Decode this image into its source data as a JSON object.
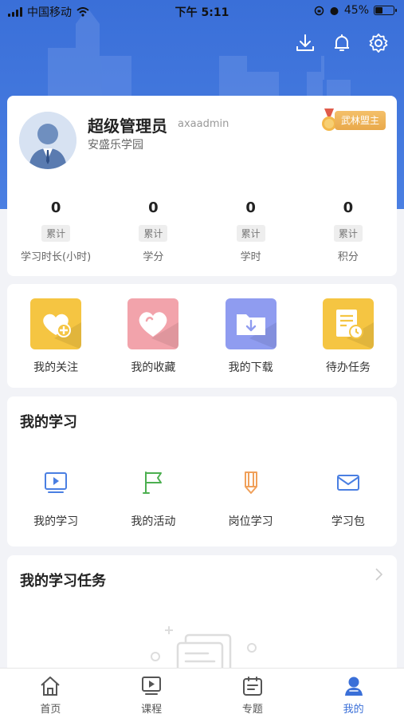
{
  "status_bar": {
    "carrier": "中国移动",
    "time": "下午 5:11",
    "battery": "45%",
    "battery_level": 0.45
  },
  "profile": {
    "name": "超级管理员",
    "account": "axaadmin",
    "org": "安盛乐学园",
    "medal": "武林盟主",
    "stats": [
      {
        "value": "0",
        "tag": "累计",
        "label": "学习时长(小时)"
      },
      {
        "value": "0",
        "tag": "累计",
        "label": "学分"
      },
      {
        "value": "0",
        "tag": "累计",
        "label": "学时"
      },
      {
        "value": "0",
        "tag": "累计",
        "label": "积分"
      }
    ]
  },
  "quick_links": [
    {
      "label": "我的关注",
      "icon": "heart-plus-icon",
      "color": "#f5c542"
    },
    {
      "label": "我的收藏",
      "icon": "heart-icon",
      "color": "#f2a3ab"
    },
    {
      "label": "我的下载",
      "icon": "download-folder-icon",
      "color": "#8f9cf0"
    },
    {
      "label": "待办任务",
      "icon": "todo-list-icon",
      "color": "#f5c542"
    }
  ],
  "my_study": {
    "title": "我的学习",
    "items": [
      {
        "label": "我的学习",
        "icon": "play-screen-icon",
        "color": "#4a7fe2"
      },
      {
        "label": "我的活动",
        "icon": "flag-icon",
        "color": "#4caf50"
      },
      {
        "label": "岗位学习",
        "icon": "pencil-icon",
        "color": "#f0a05a"
      },
      {
        "label": "学习包",
        "icon": "envelope-icon",
        "color": "#4a7fe2"
      }
    ]
  },
  "my_tasks": {
    "title": "我的学习任务"
  },
  "tabbar": [
    {
      "label": "首页",
      "icon": "home-icon",
      "active": false
    },
    {
      "label": "课程",
      "icon": "play-icon",
      "active": false
    },
    {
      "label": "专题",
      "icon": "topic-icon",
      "active": false
    },
    {
      "label": "我的",
      "icon": "user-icon",
      "active": true
    }
  ],
  "colors": {
    "primary": "#3a6fd8",
    "background": "#f2f3f7"
  }
}
